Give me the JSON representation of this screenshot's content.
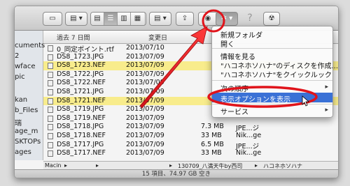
{
  "toolbar": {
    "view_icons": [
      "▤",
      "☰",
      "▥",
      "▦"
    ],
    "arrange_label": "▤ ▾",
    "share_label": "⇪",
    "eye_label": "◉",
    "gear_label": "✲ ▾",
    "help_label": "?",
    "burn_label": "☢"
  },
  "sidebar": {
    "items": [
      "cuments",
      "2",
      "wface",
      "pic",
      "kan",
      "b_Files",
      "瑞",
      "age_m",
      "SKTOPs",
      "ages",
      "us"
    ]
  },
  "columns": {
    "name": "過去 7 日間",
    "date": "変更日"
  },
  "files": [
    {
      "name": "0_同定ポイント.rtf",
      "date": "2013/07/10",
      "size": "",
      "kind": "",
      "highlight": false
    },
    {
      "name": "DS8_1723.JPG",
      "date": "2013/07/09",
      "size": "",
      "kind": "",
      "highlight": false
    },
    {
      "name": "DS8_1723.NEF",
      "date": "2013/07/09",
      "size": "",
      "kind": "",
      "highlight": true
    },
    {
      "name": "DS8_1722.JPG",
      "date": "2013/07/09",
      "size": "",
      "kind": "",
      "highlight": false
    },
    {
      "name": "DS8_1722.NEF",
      "date": "2013/07/09",
      "size": "",
      "kind": "",
      "highlight": false
    },
    {
      "name": "DS8_1721.JPG",
      "date": "2013/07/09",
      "size": "",
      "kind": "",
      "highlight": false
    },
    {
      "name": "DS8_1721.NEF",
      "date": "2013/07/09",
      "size": "",
      "kind": "",
      "highlight": true
    },
    {
      "name": "DS8_1719.JPG",
      "date": "2013/07/09",
      "size": "",
      "kind": "",
      "highlight": false
    },
    {
      "name": "DS8_1719.NEF",
      "date": "2013/07/09",
      "size": "",
      "kind": "",
      "highlight": false
    },
    {
      "name": "DS8_1718.JPG",
      "date": "2013/07/09",
      "size": "7.3 MB",
      "kind": "JPE...ジ",
      "highlight": false
    },
    {
      "name": "DS8_1718.NEF",
      "date": "2013/07/09",
      "size": "33 MB",
      "kind": "Nik...ge",
      "highlight": false
    },
    {
      "name": "DS8_1717.JPG",
      "date": "2013/07/09",
      "size": "6.5 MB",
      "kind": "JPE...ジ",
      "highlight": false
    },
    {
      "name": "DS8_1717.NEF",
      "date": "2013/07/09",
      "size": "33 MB",
      "kind": "Nik...ge",
      "highlight": false
    }
  ],
  "pathbar": {
    "segments": [
      "Macin",
      "▸",
      "▸",
      "▸",
      "130709_八満天牛by西司",
      "▸",
      "ハコネホソハナ"
    ]
  },
  "status": {
    "text": "15 項目、74.97 GB 空き"
  },
  "menu": {
    "items": [
      {
        "label": "新規フォルダ"
      },
      {
        "label": "開く"
      },
      {
        "label": "情報を見る"
      },
      {
        "label": "\"ハコネホソハナ\"のディスクを作成..."
      },
      {
        "label": "\"ハコネホソハナ\"をクイックルック"
      },
      {
        "label": "次の順序"
      },
      {
        "label": "表示オプションを表示",
        "selected": true
      },
      {
        "label": "サービス"
      }
    ]
  },
  "colors": {
    "accent": "#3a71d6",
    "highlight_row": "#f8ec8c",
    "annotation_red": "#e0141b"
  }
}
